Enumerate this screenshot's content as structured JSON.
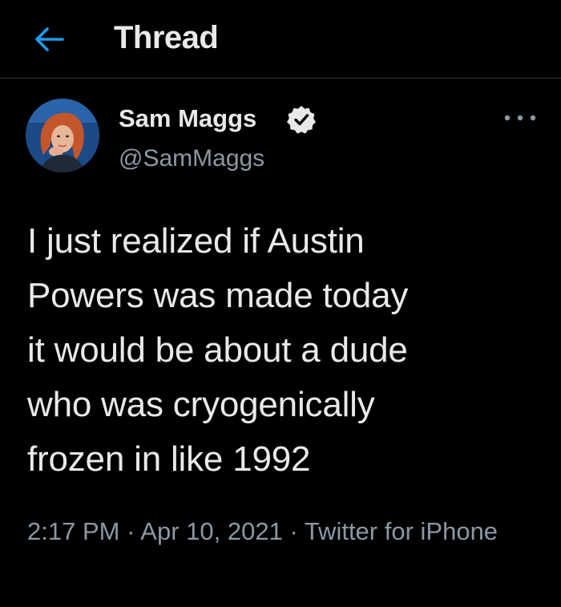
{
  "colors": {
    "background": "#000000",
    "text_primary": "#e7e9ea",
    "text_secondary": "#8b98a5",
    "accent": "#1d9bf0",
    "divider": "#2f3336"
  },
  "header": {
    "back_icon": "arrow-left-icon",
    "title": "Thread"
  },
  "tweet": {
    "author": {
      "name": "Sam Maggs",
      "handle": "@SamMaggs",
      "verified_icon": "verified-badge-icon"
    },
    "more_icon": "more-horizontal-icon",
    "text": "I just realized if Austin\nPowers was made today\nit would be about a dude\nwho was cryogenically\nfrozen in like 1992",
    "time": "2:17 PM",
    "separator": " · ",
    "date": "Apr 10, 2021",
    "source": "Twitter for iPhone"
  }
}
